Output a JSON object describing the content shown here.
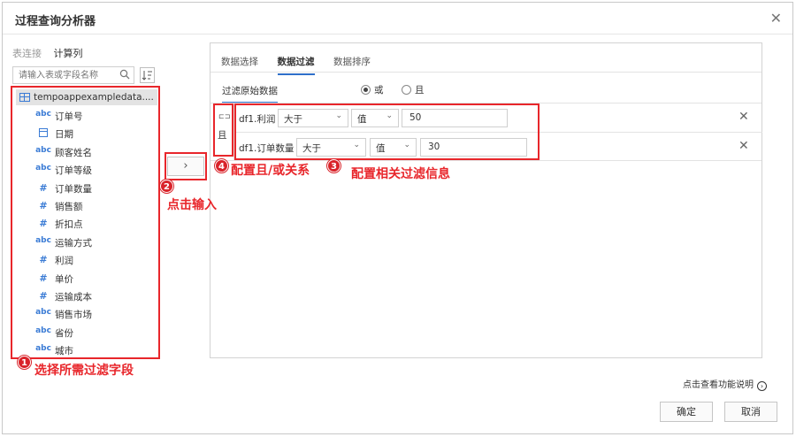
{
  "dialog": {
    "title": "过程查询分析器"
  },
  "left": {
    "tabs": [
      "表连接",
      "计算列"
    ],
    "search_placeholder": "请输入表或字段名称",
    "root": "tempoappexampledata....",
    "fields": [
      {
        "type": "abc",
        "name": "订单号"
      },
      {
        "type": "date",
        "name": "日期"
      },
      {
        "type": "abc",
        "name": "顾客姓名"
      },
      {
        "type": "abc",
        "name": "订单等级"
      },
      {
        "type": "#",
        "name": "订单数量"
      },
      {
        "type": "#",
        "name": "销售额"
      },
      {
        "type": "#",
        "name": "折扣点"
      },
      {
        "type": "abc",
        "name": "运输方式"
      },
      {
        "type": "#",
        "name": "利润"
      },
      {
        "type": "#",
        "name": "单价"
      },
      {
        "type": "#",
        "name": "运输成本"
      },
      {
        "type": "abc",
        "name": "销售市场"
      },
      {
        "type": "abc",
        "name": "省份"
      },
      {
        "type": "abc",
        "name": "城市"
      }
    ]
  },
  "transfer": {
    "label": "›"
  },
  "right": {
    "tabs": [
      "数据选择",
      "数据过滤",
      "数据排序"
    ],
    "active_tab": 1,
    "sub_label": "过滤原始数据",
    "radio_or": "或",
    "radio_and": "且",
    "relation_toggle": "⊏⊐",
    "relation": "且",
    "conditions": [
      {
        "field": "df1.利润",
        "op": "大于",
        "mode": "值",
        "value": "50"
      },
      {
        "field": "df1.订单数量",
        "op": "大于",
        "mode": "值",
        "value": "30"
      }
    ]
  },
  "annotations": {
    "n1": "1",
    "t1": "选择所需过滤字段",
    "n2": "2",
    "t2": "点击输入",
    "n3": "3",
    "t3": "配置相关过滤信息",
    "n4": "4",
    "t4": "配置且/或关系"
  },
  "footer": {
    "help": "点击查看功能说明",
    "help_icon": "›",
    "ok": "确定",
    "cancel": "取消"
  },
  "colors": {
    "accent": "#2f6fca",
    "annotation_red": "#e8262b",
    "field_icon": "#3a7bd5"
  }
}
